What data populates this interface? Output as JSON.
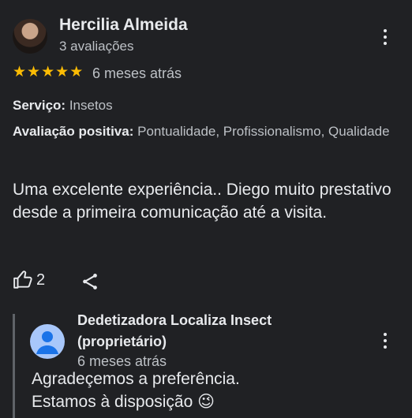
{
  "review": {
    "reviewer_name": "Hercilia Almeida",
    "review_count": "3 avaliações",
    "rating": 5,
    "stars": [
      "★",
      "★",
      "★",
      "★",
      "★"
    ],
    "time_ago": "6 meses atrás",
    "service_label": "Serviço:",
    "service_value": "Insetos",
    "positive_label": "Avaliação positiva:",
    "positive_value": "Pontualidade, Profissionalismo, Qualidade",
    "text": "Uma excelente experiência.. Diego muito prestativo desde a primeira comunicação até a visita.",
    "like_count": "2"
  },
  "owner_reply": {
    "name": "Dedetizadora Localiza Insect (proprietário)",
    "time_ago": "6 meses atrás",
    "text_line1": "Agradeçemos a preferência.",
    "text_line2": "Estamos à disposição 😉"
  },
  "colors": {
    "background": "#202124",
    "star": "#fbbc04",
    "text_primary": "#e8eaed",
    "text_secondary": "#bdc1c6"
  },
  "icons": [
    "more-vert-icon",
    "star-icon",
    "thumb-up-icon",
    "share-icon",
    "person-icon"
  ]
}
